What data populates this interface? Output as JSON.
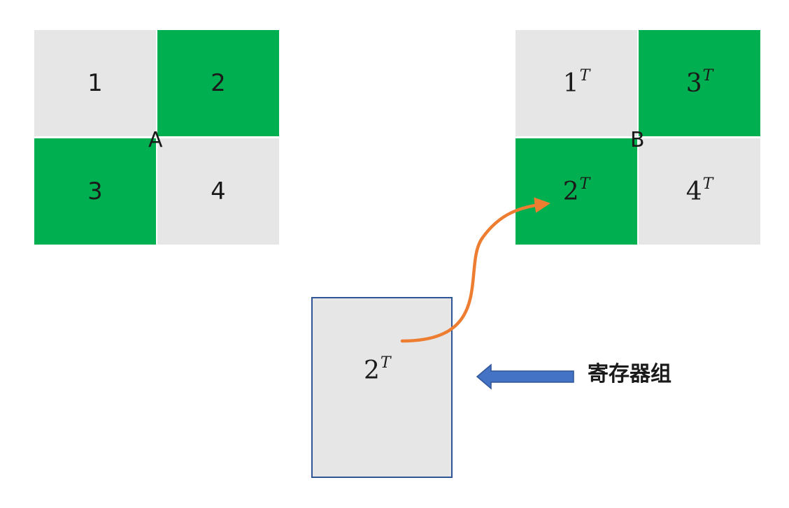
{
  "matrix_a": {
    "label": "A",
    "cells": [
      "1",
      "2",
      "3",
      "4"
    ]
  },
  "matrix_b": {
    "label": "B",
    "cells": [
      {
        "base": "1",
        "sup": "T"
      },
      {
        "base": "3",
        "sup": "T"
      },
      {
        "base": "2",
        "sup": "T"
      },
      {
        "base": "4",
        "sup": "T"
      }
    ]
  },
  "register": {
    "value": {
      "base": "2",
      "sup": "T"
    },
    "label": "寄存器组"
  },
  "colors": {
    "gray": "#e7e6e6",
    "green": "#00b050",
    "register_border": "#2f5597",
    "orange_arrow": "#ed7d31",
    "blue_arrow": "#4472c4"
  }
}
